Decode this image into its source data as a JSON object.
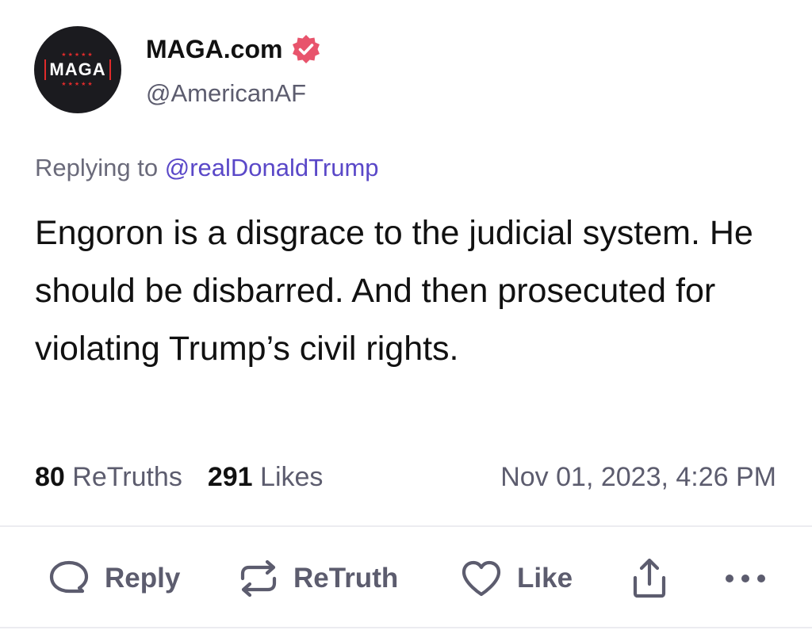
{
  "author": {
    "display_name": "MAGA.com",
    "handle": "@AmericanAF",
    "avatar_text": "MAGA",
    "verified_color": "#e8546c"
  },
  "reply": {
    "prefix": "Replying to",
    "mention": "@realDonaldTrump"
  },
  "post": {
    "text": "Engoron is a disgrace to the judicial system. He should be disbarred. And then prosecuted for violating Trump’s civil rights."
  },
  "stats": {
    "retruths_count": "80",
    "retruths_label": "ReTruths",
    "likes_count": "291",
    "likes_label": "Likes",
    "timestamp": "Nov 01, 2023, 4:26 PM"
  },
  "actions": {
    "reply": "Reply",
    "retruth": "ReTruth",
    "like": "Like",
    "share_icon": "share-icon",
    "more_icon": "more-icon"
  },
  "colors": {
    "accent": "#5a48c8",
    "brand_red": "#e02b2b",
    "muted": "#5c5c6e"
  }
}
